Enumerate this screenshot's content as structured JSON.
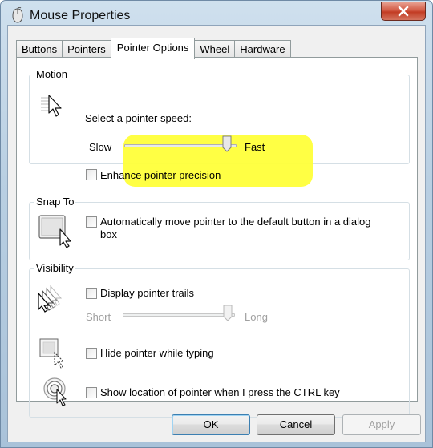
{
  "window": {
    "title": "Mouse Properties",
    "icons": {
      "app": "mouse-icon",
      "close": "close-icon"
    }
  },
  "tabs": [
    {
      "label": "Buttons",
      "active": false
    },
    {
      "label": "Pointers",
      "active": false
    },
    {
      "label": "Pointer Options",
      "active": true
    },
    {
      "label": "Wheel",
      "active": false
    },
    {
      "label": "Hardware",
      "active": false
    }
  ],
  "motion": {
    "title": "Motion",
    "speed_label": "Select a pointer speed:",
    "slow_label": "Slow",
    "fast_label": "Fast",
    "speed_level": 1.0,
    "enhance_label": "Enhance pointer precision",
    "enhance_checked": false,
    "icon": "pointer-speed-icon"
  },
  "snap": {
    "title": "Snap To",
    "label_line1": "Automatically move pointer to the default button in a dialog",
    "label_line2": "box",
    "checked": false,
    "icon": "snap-to-icon"
  },
  "visibility": {
    "title": "Visibility",
    "trails_label": "Display pointer trails",
    "trails_checked": false,
    "short_label": "Short",
    "long_label": "Long",
    "trail_level": 1.0,
    "hide_label": "Hide pointer while typing",
    "hide_checked": false,
    "ctrl_label": "Show location of pointer when I press the CTRL key",
    "ctrl_checked": false,
    "icons": [
      "pointer-trails-icon",
      "hide-pointer-icon",
      "pointer-location-icon"
    ]
  },
  "footer": {
    "ok_label": "OK",
    "cancel_label": "Cancel",
    "apply_label": "Apply"
  },
  "colors": {
    "highlight": "#ffff3a"
  }
}
